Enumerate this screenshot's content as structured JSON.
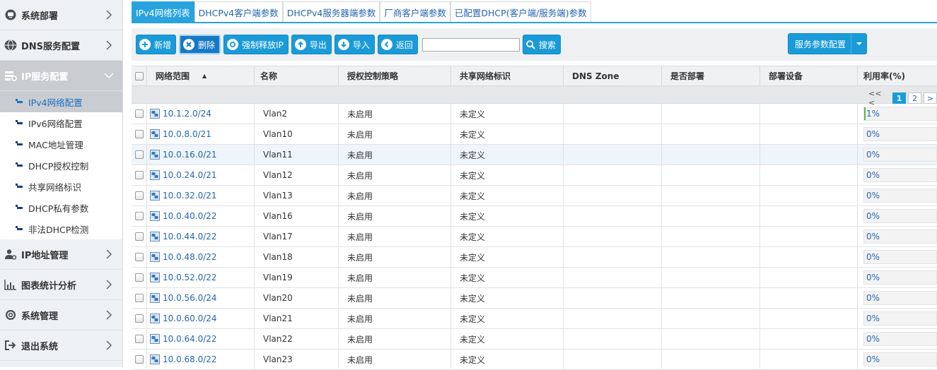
{
  "sidebar": {
    "groups_top": [
      {
        "label": "系统部署",
        "icon": "monitor-icon"
      },
      {
        "label": "DNS服务配置",
        "icon": "globe-icon"
      },
      {
        "label": "IP服务配置",
        "icon": "server-config-icon"
      }
    ],
    "sub_items": [
      {
        "label": "IPv4网络配置"
      },
      {
        "label": "IPv6网络配置"
      },
      {
        "label": "MAC地址管理"
      },
      {
        "label": "DHCP授权控制"
      },
      {
        "label": "共享网络标识"
      },
      {
        "label": "DHCP私有参数"
      },
      {
        "label": "非法DHCP检测"
      }
    ],
    "groups_bottom": [
      {
        "label": "IP地址管理",
        "icon": "user-gear-icon"
      },
      {
        "label": "图表统计分析",
        "icon": "bar-chart-icon"
      },
      {
        "label": "系统管理",
        "icon": "gear-icon"
      },
      {
        "label": "退出系统",
        "icon": "logout-icon"
      }
    ]
  },
  "tabs": [
    "IPv4网络列表",
    "DHCPv4客户端参数",
    "DHCPv4服务器端参数",
    "厂商客户端参数",
    "已配置DHCP(客户端/服务端)参数"
  ],
  "toolbar": {
    "add": "新增",
    "delete": "删除",
    "release": "强制释放IP",
    "export": "导出",
    "import": "导入",
    "back": "返回",
    "search_value": "",
    "search": "搜索",
    "config": "服务参数配置"
  },
  "table": {
    "headers": {
      "network": "网络范围",
      "name": "名称",
      "policy": "授权控制策略",
      "shared": "共享网络标识",
      "dns": "DNS Zone",
      "deployed": "是否部署",
      "device": "部署设备",
      "util": "利用率(%)"
    },
    "pager": {
      "prev": "<< <",
      "pages": [
        "1",
        "2"
      ],
      "next": ">"
    },
    "rows": [
      {
        "network": "10.1.2.0/24",
        "name": "Vlan2",
        "policy": "未启用",
        "shared": "未定义",
        "util": "1%",
        "util_value": 0.01
      },
      {
        "network": "10.0.8.0/21",
        "name": "Vlan10",
        "policy": "未启用",
        "shared": "未定义",
        "util": "0%",
        "util_value": 0
      },
      {
        "network": "10.0.16.0/21",
        "name": "Vlan11",
        "policy": "未启用",
        "shared": "未定义",
        "util": "0%",
        "util_value": 0
      },
      {
        "network": "10.0.24.0/21",
        "name": "Vlan12",
        "policy": "未启用",
        "shared": "未定义",
        "util": "0%",
        "util_value": 0
      },
      {
        "network": "10.0.32.0/21",
        "name": "Vlan13",
        "policy": "未启用",
        "shared": "未定义",
        "util": "0%",
        "util_value": 0
      },
      {
        "network": "10.0.40.0/22",
        "name": "Vlan16",
        "policy": "未启用",
        "shared": "未定义",
        "util": "0%",
        "util_value": 0
      },
      {
        "network": "10.0.44.0/22",
        "name": "Vlan17",
        "policy": "未启用",
        "shared": "未定义",
        "util": "0%",
        "util_value": 0
      },
      {
        "network": "10.0.48.0/22",
        "name": "Vlan18",
        "policy": "未启用",
        "shared": "未定义",
        "util": "0%",
        "util_value": 0
      },
      {
        "network": "10.0.52.0/22",
        "name": "Vlan19",
        "policy": "未启用",
        "shared": "未定义",
        "util": "0%",
        "util_value": 0
      },
      {
        "network": "10.0.56.0/24",
        "name": "Vlan20",
        "policy": "未启用",
        "shared": "未定义",
        "util": "0%",
        "util_value": 0
      },
      {
        "network": "10.0.60.0/24",
        "name": "Vlan21",
        "policy": "未启用",
        "shared": "未定义",
        "util": "0%",
        "util_value": 0
      },
      {
        "network": "10.0.64.0/22",
        "name": "Vlan22",
        "policy": "未启用",
        "shared": "未定义",
        "util": "0%",
        "util_value": 0
      },
      {
        "network": "10.0.68.0/22",
        "name": "Vlan23",
        "policy": "未启用",
        "shared": "未定义",
        "util": "0%",
        "util_value": 0
      }
    ]
  },
  "colors": {
    "accent": "#1a9bd9",
    "tab_active": "#29a3de",
    "link": "#2565b0",
    "util_fill": "#56b949"
  }
}
